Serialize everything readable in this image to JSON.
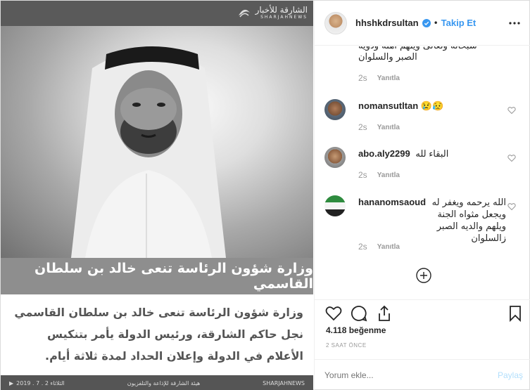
{
  "image": {
    "brand_ar": "الشارقة للأخبار",
    "brand_en": "SHARJAHNEWS",
    "headline": "وزارة شؤون الرئاسة تنعى خالد بن سلطان القاسمي",
    "body": "وزارة شؤون الرئاسة تنعى خالد بن سلطان القاسمي نجل حاكم الشارقة، ورئيس الدولة يأمر بتنكيس الأعلام في الدولة وإعلان الحداد لمدة ثلاثة أيام.",
    "footer_handle": "SHARJAHNEWS",
    "footer_org": "هيئة الشارقة للإذاعة والتلفزيون",
    "footer_date": "2019 . 7 . 2 الثلاثاء"
  },
  "header": {
    "username": "hhshkdrsultan",
    "separator": "•",
    "follow_label": "Takip Et"
  },
  "comments": {
    "continued_text": "سبحانه وتعالى ويلهم اهله وذويه الصبر والسلوان",
    "continued_time": "2s",
    "reply_label": "Yanıtla",
    "items": [
      {
        "user": "nomansutltan",
        "text": "😢😥",
        "time": "2s"
      },
      {
        "user": "abo.aly2299",
        "text": "البقاء لله",
        "time": "2s"
      },
      {
        "user": "hananomsaoud",
        "text": "الله يرحمه ويغفر له ويجعل مثواه الجنة ويلهم والديه الصبر زالسلوان",
        "time": "2s"
      }
    ]
  },
  "stats": {
    "likes": "4.118 beğenme",
    "time_ago": "2 SAAT ÖNCE"
  },
  "comment_box": {
    "placeholder": "Yorum ekle...",
    "post_label": "Paylaş"
  },
  "colors": {
    "accent": "#3897f0",
    "verified": "#3897f0"
  }
}
